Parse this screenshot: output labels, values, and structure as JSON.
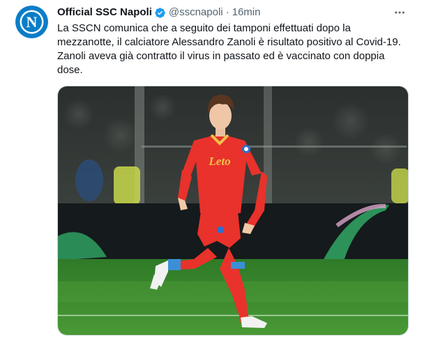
{
  "tweet": {
    "author_name": "Official SSC Napoli",
    "handle": "@sscnapoli",
    "separator": "·",
    "time": "16min",
    "text": "La SSCN comunica che a seguito dei tamponi effettuati dopo la\nmezzanotte, il calciatore Alessandro Zanoli è risultato positivo al Covid-19.\nZanoli aveva già contratto il virus in passato ed è vaccinato con doppia\ndose.",
    "avatar_letter": "N",
    "jersey_sponsor": "Leto"
  },
  "icons": {
    "verified": "verified-badge-icon",
    "more": "more-options-icon",
    "avatar": "napoli-crest-icon"
  },
  "colors": {
    "verified": "#1d9bf0",
    "napoli_blue": "#0a7dc8",
    "jersey": "#e8322b",
    "pitch": "#3a8a2e"
  }
}
